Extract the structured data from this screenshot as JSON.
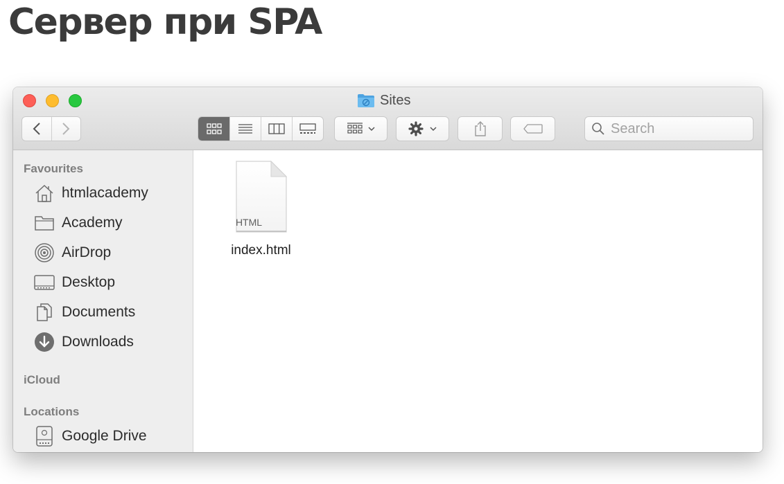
{
  "slide": {
    "title": "Сервер при SPA"
  },
  "window": {
    "title": "Sites",
    "title_icon": "folder-icon",
    "traffic_lights": {
      "close": "#fd5f57",
      "minimize": "#febc2e",
      "zoom": "#28c840"
    }
  },
  "toolbar": {
    "back_icon": "chevron-left-icon",
    "forward_icon": "chevron-right-icon",
    "view_modes": [
      {
        "icon": "icon-view-icon",
        "active": true
      },
      {
        "icon": "list-view-icon",
        "active": false
      },
      {
        "icon": "column-view-icon",
        "active": false
      },
      {
        "icon": "gallery-view-icon",
        "active": false
      }
    ],
    "arrange_icon": "group-arrange-icon",
    "action_icon": "gear-icon",
    "share_icon": "share-icon",
    "tag_icon": "tag-icon",
    "search_placeholder": "Search"
  },
  "sidebar": {
    "favourites_heading": "Favourites",
    "favourites": [
      {
        "label": "htmlacademy",
        "icon": "home-icon"
      },
      {
        "label": "Academy",
        "icon": "folder-icon"
      },
      {
        "label": "AirDrop",
        "icon": "airdrop-icon"
      },
      {
        "label": "Desktop",
        "icon": "desktop-icon"
      },
      {
        "label": "Documents",
        "icon": "documents-icon"
      },
      {
        "label": "Downloads",
        "icon": "download-circle-icon"
      }
    ],
    "icloud_heading": "iCloud",
    "locations_heading": "Locations",
    "locations": [
      {
        "label": "Google Drive",
        "icon": "drive-icon",
        "eject_icon": "eject-icon"
      }
    ]
  },
  "content": {
    "files": [
      {
        "name": "index.html",
        "badge": "HTML",
        "icon": "html-file-icon"
      }
    ]
  }
}
